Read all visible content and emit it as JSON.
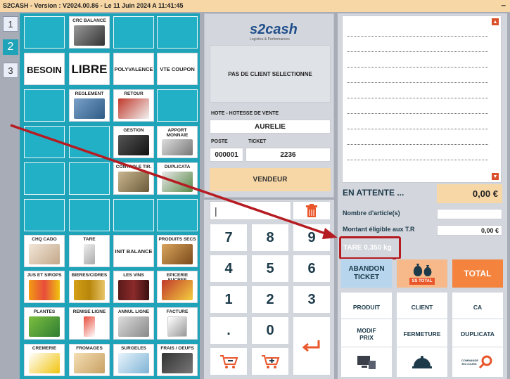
{
  "titlebar": {
    "title": "S2CASH - Version : V2024.00.86 - Le 11 Juin 2024 A 11:41:45",
    "min": "–"
  },
  "page_tabs": [
    "1",
    "2",
    "3"
  ],
  "tiles": {
    "crc_balance": "CRC BALANCE",
    "besoin": "BESOIN",
    "libre": "LIBRE",
    "polyvalence": "POLYVALENCE",
    "vte_coupon": "VTE COUPON",
    "reglement": "REGLEMENT",
    "retour": "RETOUR",
    "gestion": "GESTION",
    "apport_monnaie": "APPORT MONNAIE",
    "controle_tir": "CONTROLE TIR.",
    "duplicata": "DUPLICATA",
    "chq_cado": "CHQ CADO",
    "tare": "TARE",
    "init_balance": "INIT BALANCE",
    "produits_secs": "PRODUITS SECS",
    "jus_sirops": "JUS ET SIROPS",
    "bieres_cidres": "BIERES/CIDRES",
    "les_vins": "LES VINS",
    "epicerie_sucree": "EPICERIE SUCREE",
    "plantes": "PLANTES",
    "remise_ligne": "REMISE LIGNE",
    "annul_ligne": "ANNUL LIGNE",
    "facture": "FACTURE",
    "cremerie": "CREMERIE",
    "fromages": "FROMAGES",
    "surgeles": "SURGELES",
    "frais_oeufs": "FRAIS / OEUFS"
  },
  "center": {
    "logo_text": "s2cash",
    "logo_sub": "Logistics & Performances",
    "no_client": "PAS DE CLIENT SELECTIONNE",
    "hote_label": "HOTE - HOTESSE DE VENTE",
    "hote_value": "AURELIE",
    "poste_label": "POSTE",
    "ticket_label": "TICKET",
    "poste_value": "000001",
    "ticket_value": "2236",
    "vendeur": "VENDEUR"
  },
  "keypad": {
    "keys": [
      "7",
      "8",
      "9",
      "4",
      "5",
      "6",
      "1",
      "2",
      "3",
      ".",
      "0"
    ]
  },
  "right": {
    "en_attente_label": "EN ATTENTE ...",
    "en_attente_value": "0,00 €",
    "nb_articles_label": "Nombre d'article(s)",
    "nb_articles_value": "",
    "montant_label": "Montant éligible aux T.R",
    "montant_value": "0,00 €",
    "tare_label": "TARE  0,350 kg",
    "abandon": "ABANDON TICKET",
    "ss_total": "SS TOTAL",
    "total": "TOTAL",
    "produit": "PRODUIT",
    "client": "CLIENT",
    "ca": "CA",
    "modif_prix": "MODIF PRIX",
    "fermeture": "FERMETURE",
    "duplicata": "DUPLICATA",
    "commande_en_cours": "COMMANDE EN COURS"
  },
  "colors": {
    "teal": "#1ea3b8",
    "peach": "#f7d7a6",
    "orange": "#f4833d",
    "highlight_red": "#b51c22"
  }
}
